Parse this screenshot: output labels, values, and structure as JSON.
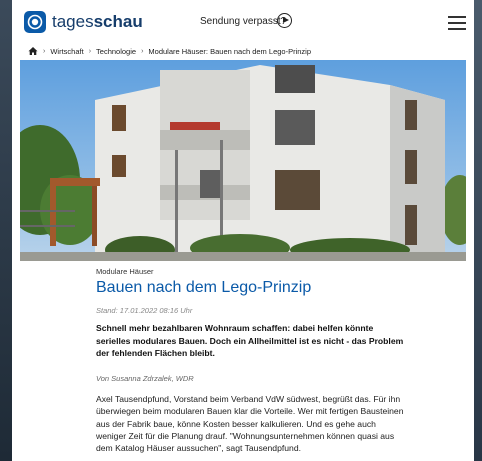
{
  "header": {
    "logo_text_light": "tages",
    "logo_text_bold": "schau",
    "missed_label": "Sendung verpasst?",
    "icons": {
      "logo": "tagesschau-logo-icon",
      "play": "play-icon",
      "menu": "hamburger-menu-icon"
    }
  },
  "breadcrumb": {
    "home_icon": "home-icon",
    "items": [
      "Wirtschaft",
      "Technologie",
      "Modulare Häuser: Bauen nach dem Lego-Prinzip"
    ]
  },
  "hero": {
    "description_alt": "Modulares Wohnhaus"
  },
  "article": {
    "topline": "Modulare Häuser",
    "headline": "Bauen nach dem Lego-Prinzip",
    "date": "Stand: 17.01.2022 08:16 Uhr",
    "intro": "Schnell mehr bezahlbaren Wohnraum schaffen: dabei helfen könnte serielles modulares Bauen. Doch ein Allheilmittel ist es nicht - das Problem der fehlenden Flächen bleibt.",
    "author": "Von Susanna Zdrzalek, WDR",
    "body": "Axel Tausendpfund, Vorstand beim Verband VdW südwest, begrüßt das. Für ihn überwiegen beim modularen Bauen klar die Vorteile. Wer mit fertigen Bausteinen aus der Fabrik baue, könne Kosten besser kalkulieren. Und es gehe auch weniger Zeit für die Planung drauf. \"Wohnungsunternehmen können quasi aus dem Katalog Häuser aussuchen\", sagt Tausendpfund."
  },
  "colors": {
    "accent": "#0b5aa8",
    "brand_dark": "#163d6b"
  }
}
